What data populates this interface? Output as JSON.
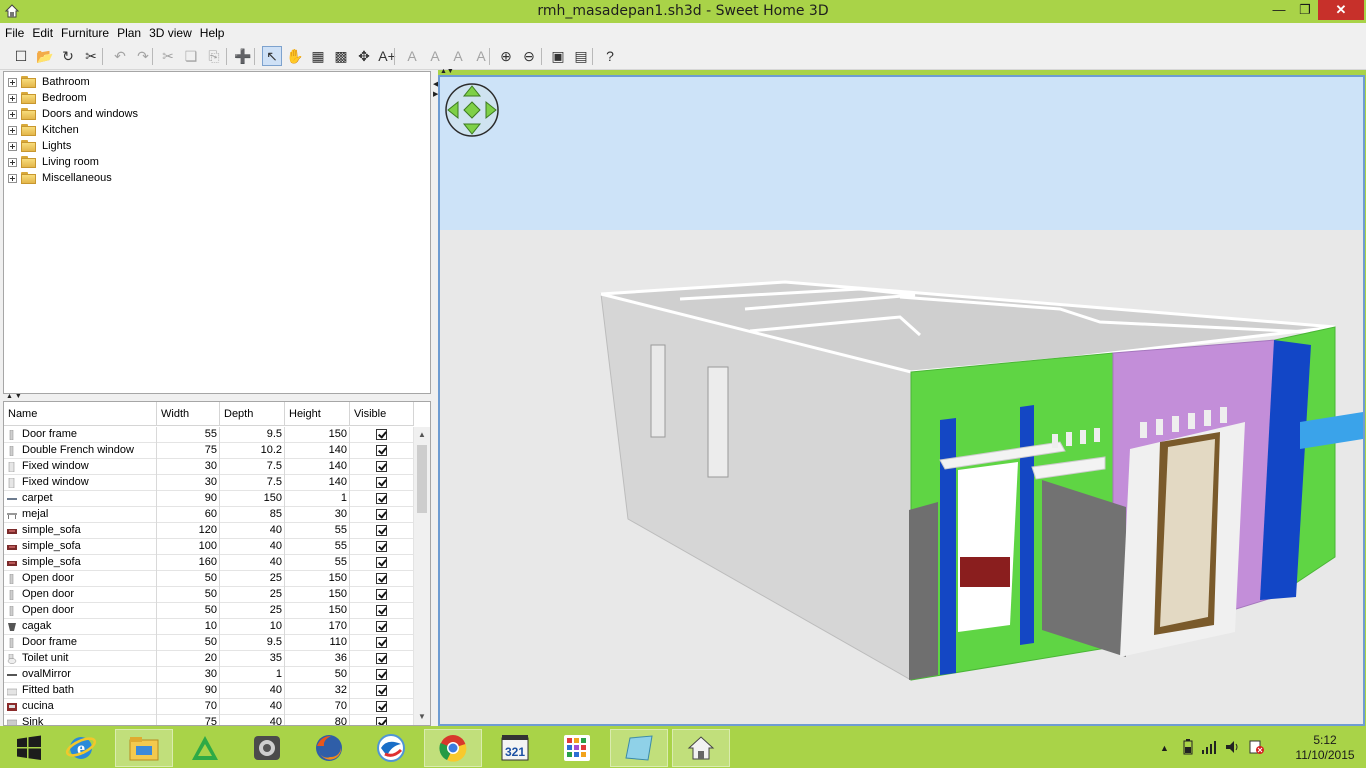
{
  "window": {
    "title": "rmh_masadepan1.sh3d - Sweet Home 3D",
    "minimize": "—",
    "maximize": "❐",
    "close": "✕"
  },
  "menu": [
    "File",
    "Edit",
    "Furniture",
    "Plan",
    "3D view",
    "Help"
  ],
  "toolbar": [
    {
      "name": "new-home-icon",
      "glyph": "☐",
      "dim": false
    },
    {
      "name": "open-icon",
      "glyph": "📂",
      "dim": false
    },
    {
      "name": "save-icon",
      "glyph": "↻",
      "dim": false
    },
    {
      "name": "preferences-icon",
      "glyph": "✂",
      "dim": false
    },
    {
      "name": "undo-icon",
      "glyph": "↶",
      "dim": true
    },
    {
      "name": "redo-icon",
      "glyph": "↷",
      "dim": true
    },
    {
      "name": "cut-icon",
      "glyph": "✂",
      "dim": true
    },
    {
      "name": "copy-icon",
      "glyph": "❏",
      "dim": true
    },
    {
      "name": "paste-icon",
      "glyph": "⎘",
      "dim": true
    },
    {
      "name": "add-furniture-icon",
      "glyph": "➕",
      "dim": true
    },
    {
      "name": "select-mode-icon",
      "glyph": "↖",
      "dim": false,
      "pressed": true
    },
    {
      "name": "pan-mode-icon",
      "glyph": "✋",
      "dim": false
    },
    {
      "name": "create-walls-icon",
      "glyph": "▦",
      "dim": false
    },
    {
      "name": "create-rooms-icon",
      "glyph": "▩",
      "dim": false
    },
    {
      "name": "create-dimensions-icon",
      "glyph": "✥",
      "dim": false
    },
    {
      "name": "add-text-icon",
      "glyph": "A+",
      "dim": false
    },
    {
      "name": "increase-text-icon",
      "glyph": "A",
      "dim": true
    },
    {
      "name": "decrease-text-icon",
      "glyph": "A",
      "dim": true
    },
    {
      "name": "bold-text-icon",
      "glyph": "A",
      "dim": true
    },
    {
      "name": "italic-text-icon",
      "glyph": "A",
      "dim": true
    },
    {
      "name": "zoom-in-icon",
      "glyph": "⊕",
      "dim": false
    },
    {
      "name": "zoom-out-icon",
      "glyph": "⊖",
      "dim": false
    },
    {
      "name": "create-photo-icon",
      "glyph": "▣",
      "dim": false
    },
    {
      "name": "create-video-icon",
      "glyph": "▤",
      "dim": false
    },
    {
      "name": "help-icon",
      "glyph": "?",
      "dim": false
    }
  ],
  "catalog": [
    "Bathroom",
    "Bedroom",
    "Doors and windows",
    "Kitchen",
    "Lights",
    "Living room",
    "Miscellaneous"
  ],
  "furniture_table": {
    "columns": [
      "Name",
      "Width",
      "Depth",
      "Height",
      "Visible"
    ],
    "rows": [
      {
        "name": "Door frame",
        "width": "55",
        "depth": "9.5",
        "height": "150",
        "icon": "door"
      },
      {
        "name": "Double French window",
        "width": "75",
        "depth": "10.2",
        "height": "140",
        "icon": "door"
      },
      {
        "name": "Fixed window",
        "width": "30",
        "depth": "7.5",
        "height": "140",
        "icon": "window"
      },
      {
        "name": "Fixed window",
        "width": "30",
        "depth": "7.5",
        "height": "140",
        "icon": "window"
      },
      {
        "name": "carpet",
        "width": "90",
        "depth": "150",
        "height": "1",
        "icon": "carpet"
      },
      {
        "name": "mejal",
        "width": "60",
        "depth": "85",
        "height": "30",
        "icon": "table"
      },
      {
        "name": "simple_sofa",
        "width": "120",
        "depth": "40",
        "height": "55",
        "icon": "sofa"
      },
      {
        "name": "simple_sofa",
        "width": "100",
        "depth": "40",
        "height": "55",
        "icon": "sofa"
      },
      {
        "name": "simple_sofa",
        "width": "160",
        "depth": "40",
        "height": "55",
        "icon": "sofa"
      },
      {
        "name": "Open door",
        "width": "50",
        "depth": "25",
        "height": "150",
        "icon": "door"
      },
      {
        "name": "Open door",
        "width": "50",
        "depth": "25",
        "height": "150",
        "icon": "door"
      },
      {
        "name": "Open door",
        "width": "50",
        "depth": "25",
        "height": "150",
        "icon": "door"
      },
      {
        "name": "cagak",
        "width": "10",
        "depth": "10",
        "height": "170",
        "icon": "pillar"
      },
      {
        "name": "Door frame",
        "width": "50",
        "depth": "9.5",
        "height": "110",
        "icon": "door"
      },
      {
        "name": "Toilet unit",
        "width": "20",
        "depth": "35",
        "height": "36",
        "icon": "toilet"
      },
      {
        "name": "ovalMirror",
        "width": "30",
        "depth": "1",
        "height": "50",
        "icon": "mirror"
      },
      {
        "name": "Fitted bath",
        "width": "90",
        "depth": "40",
        "height": "32",
        "icon": "bath"
      },
      {
        "name": "cucina",
        "width": "70",
        "depth": "40",
        "height": "70",
        "icon": "kitchen"
      },
      {
        "name": "Sink",
        "width": "75",
        "depth": "40",
        "height": "80",
        "icon": "sink"
      }
    ]
  },
  "taskbar": {
    "apps": [
      "windows-start-icon",
      "internet-explorer-icon",
      "file-explorer-icon",
      "app-triangle-icon",
      "camera-app-icon",
      "firefox-icon",
      "blue-swirl-app-icon",
      "chrome-icon",
      "media-player-321-icon",
      "grid-app-icon",
      "notes-app-icon",
      "sweet-home-3d-icon"
    ],
    "time": "5:12",
    "date": "11/10/2015"
  }
}
